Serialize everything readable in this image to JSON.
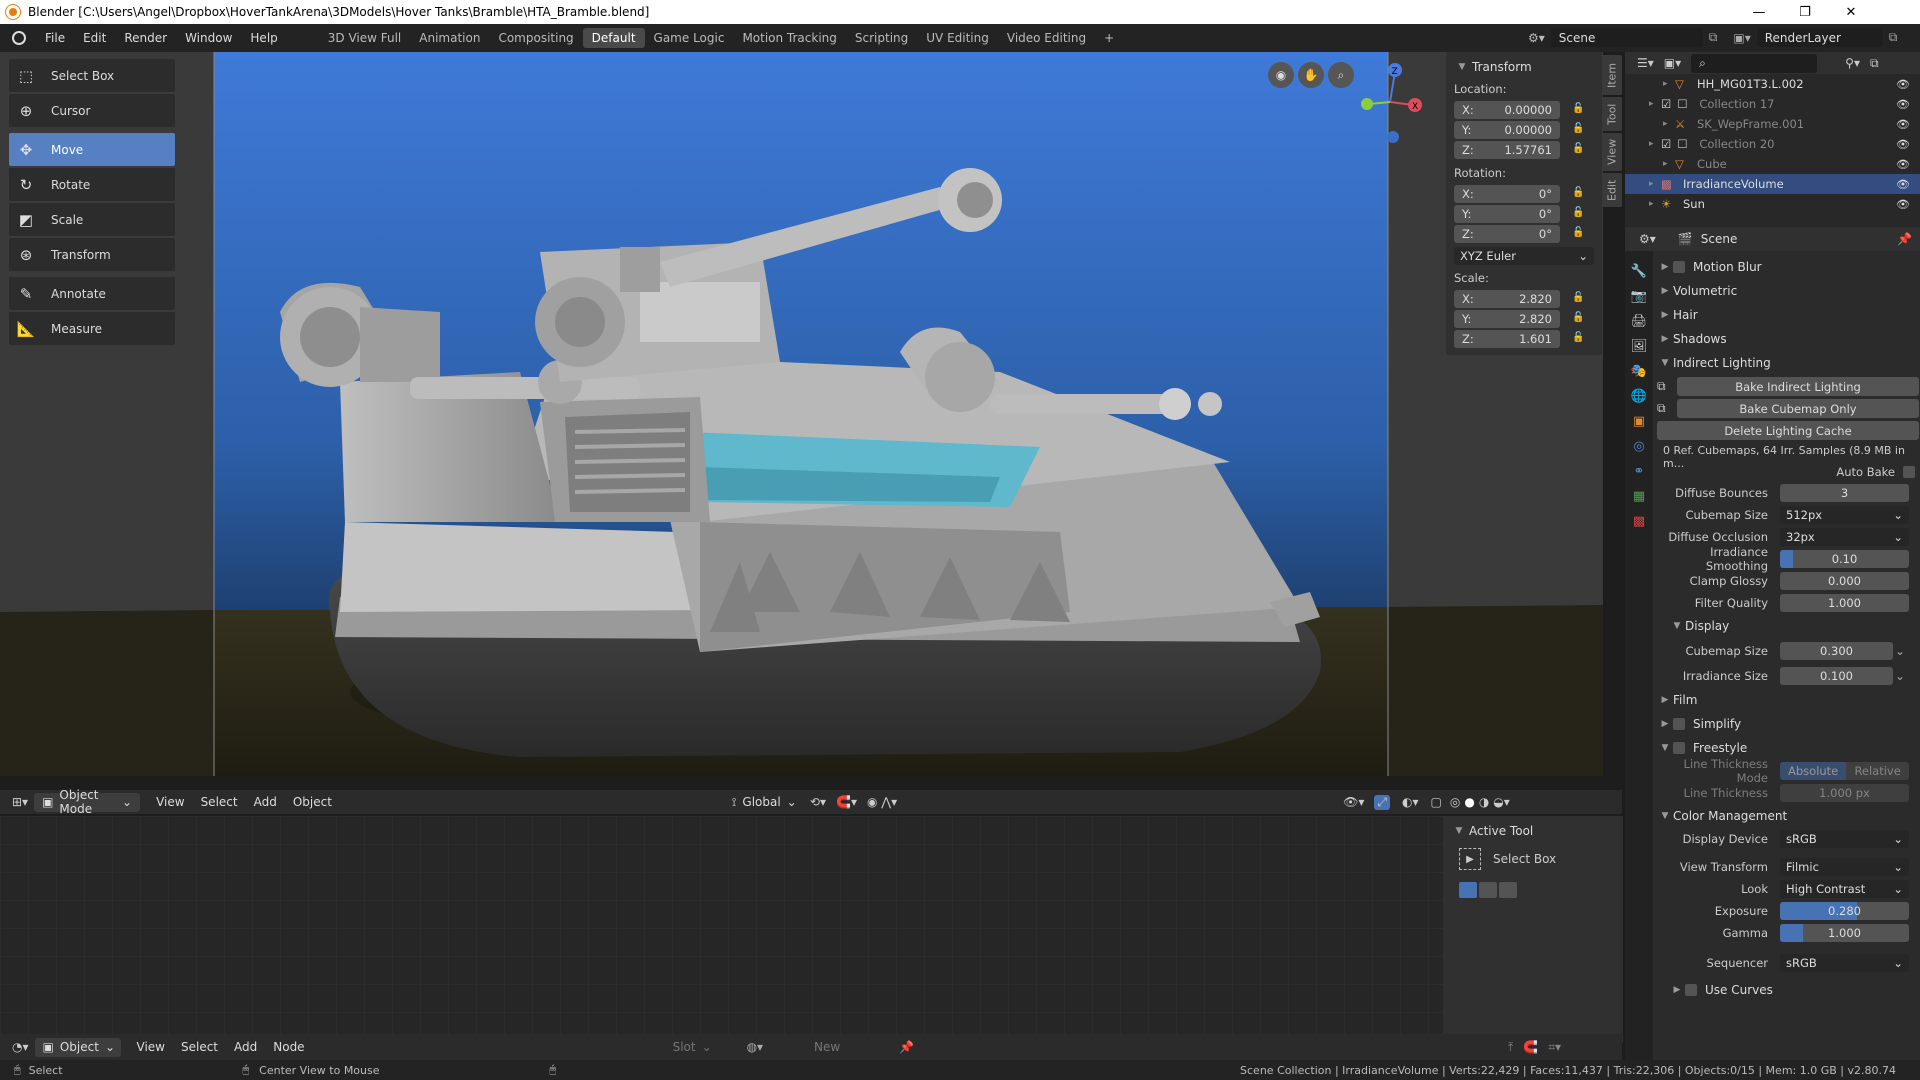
{
  "titlebar": {
    "title": "Blender [C:\\Users\\Angel\\Dropbox\\HoverTankArena\\3DModels\\Hover Tanks\\Bramble\\HTA_Bramble.blend]",
    "minimize": "—",
    "maximize": "❐",
    "close": "✕"
  },
  "menus": [
    "File",
    "Edit",
    "Render",
    "Window",
    "Help"
  ],
  "workspaces": [
    {
      "label": "3D View Full"
    },
    {
      "label": "Animation"
    },
    {
      "label": "Compositing"
    },
    {
      "label": "Default",
      "active": true
    },
    {
      "label": "Game Logic"
    },
    {
      "label": "Motion Tracking"
    },
    {
      "label": "Scripting"
    },
    {
      "label": "UV Editing"
    },
    {
      "label": "Video Editing"
    }
  ],
  "workspace_add": "+",
  "scene": {
    "label": "Scene",
    "render_layer": "RenderLayer"
  },
  "tools": [
    {
      "label": "Select Box",
      "icon": "select-box-icon"
    },
    {
      "label": "Cursor",
      "icon": "cursor-icon"
    },
    {
      "label": "Move",
      "icon": "move-icon",
      "active": true
    },
    {
      "label": "Rotate",
      "icon": "rotate-icon"
    },
    {
      "label": "Scale",
      "icon": "scale-icon"
    },
    {
      "label": "Transform",
      "icon": "transform-icon"
    },
    {
      "label": "Annotate",
      "icon": "annotate-icon"
    },
    {
      "label": "Measure",
      "icon": "measure-icon"
    }
  ],
  "transform": {
    "title": "Transform",
    "location_label": "Location:",
    "location": [
      {
        "axis": "X:",
        "value": "0.00000"
      },
      {
        "axis": "Y:",
        "value": "0.00000"
      },
      {
        "axis": "Z:",
        "value": "1.57761"
      }
    ],
    "rotation_label": "Rotation:",
    "rotation": [
      {
        "axis": "X:",
        "value": "0°"
      },
      {
        "axis": "Y:",
        "value": "0°"
      },
      {
        "axis": "Z:",
        "value": "0°"
      }
    ],
    "rotation_mode": "XYZ Euler",
    "scale_label": "Scale:",
    "scale": [
      {
        "axis": "X:",
        "value": "2.820"
      },
      {
        "axis": "Y:",
        "value": "2.820"
      },
      {
        "axis": "Z:",
        "value": "1.601"
      }
    ]
  },
  "sidebar_tabs": [
    "Item",
    "Tool",
    "View",
    "Edit"
  ],
  "viewport_header": {
    "mode": "Object Mode",
    "menus": [
      "View",
      "Select",
      "Add",
      "Object"
    ],
    "orientation": "Global"
  },
  "active_tool": {
    "title": "Active Tool",
    "tool": "Select Box"
  },
  "node_header": {
    "mode": "Object",
    "menus": [
      "View",
      "Select",
      "Add",
      "Node"
    ],
    "slot": "Slot",
    "new": "New"
  },
  "outliner": [
    {
      "label": "HH_MG01T3.L.002",
      "indent": 2,
      "icon": "mesh-icon",
      "visible": true
    },
    {
      "label": "Collection 17",
      "indent": 1,
      "icon": "collection-icon",
      "dim": true
    },
    {
      "label": "SK_WepFrame.001",
      "indent": 2,
      "icon": "armature-icon",
      "dim": true
    },
    {
      "label": "Collection 20",
      "indent": 1,
      "icon": "collection-icon",
      "dim": true
    },
    {
      "label": "Cube",
      "indent": 2,
      "icon": "mesh-icon",
      "dim": true
    },
    {
      "label": "IrradianceVolume",
      "indent": 1,
      "icon": "irradiance-icon",
      "selected": true
    },
    {
      "label": "Sun",
      "indent": 1,
      "icon": "light-icon"
    }
  ],
  "properties": {
    "context": "Scene",
    "motion_blur": "Motion Blur",
    "volumetric": "Volumetric",
    "hair": "Hair",
    "shadows": "Shadows",
    "indirect_lighting": "Indirect Lighting",
    "bake_indirect": "Bake Indirect Lighting",
    "bake_cubemap": "Bake Cubemap Only",
    "delete_cache": "Delete Lighting Cache",
    "cache_info": "0 Ref. Cubemaps, 64 Irr. Samples (8.9 MB in m...",
    "auto_bake": "Auto Bake",
    "fields": [
      {
        "k": "Diffuse Bounces",
        "v": "3",
        "type": "num"
      },
      {
        "k": "Cubemap Size",
        "v": "512px",
        "type": "sel"
      },
      {
        "k": "Diffuse Occlusion",
        "v": "32px",
        "type": "sel"
      },
      {
        "k": "Irradiance Smoothing",
        "v": "0.10",
        "type": "bar",
        "fill": 0.1
      },
      {
        "k": "Clamp Glossy",
        "v": "0.000",
        "type": "num"
      },
      {
        "k": "Filter Quality",
        "v": "1.000",
        "type": "num"
      }
    ],
    "display": "Display",
    "display_fields": [
      {
        "k": "Cubemap Size",
        "v": "0.300"
      },
      {
        "k": "Irradiance Size",
        "v": "0.100"
      }
    ],
    "film": "Film",
    "simplify": "Simplify",
    "freestyle": "Freestyle",
    "line_thickness_mode": "Line Thickness Mode",
    "absolute": "Absolute",
    "relative": "Relative",
    "line_thickness": "Line Thickness",
    "line_thickness_value": "1.000 px",
    "color_management": "Color Management",
    "cm_fields": [
      {
        "k": "Display Device",
        "v": "sRGB",
        "type": "sel"
      },
      {
        "k": "View Transform",
        "v": "Filmic",
        "type": "sel"
      },
      {
        "k": "Look",
        "v": "High Contrast",
        "type": "sel"
      },
      {
        "k": "Exposure",
        "v": "0.280",
        "type": "bar",
        "fill": 0.6
      },
      {
        "k": "Gamma",
        "v": "1.000",
        "type": "bar",
        "fill": 0.18
      }
    ],
    "sequencer": "Sequencer",
    "sequencer_value": "sRGB",
    "use_curves": "Use Curves"
  },
  "status": {
    "select": "Select",
    "center": "Center View to Mouse",
    "info": "Scene Collection | IrradianceVolume | Verts:22,429 | Faces:11,437 | Tris:22,306 | Objects:0/15 | Mem: 1.0 GB | v2.80.74"
  },
  "colors": {
    "accent": "#4772b3",
    "active_tool": "#5680c2",
    "sky_top": "#3d78d6",
    "sky_bottom": "#1f4a8a",
    "ground": "#2a2a1c",
    "tank": "#8e8e8e",
    "glass": "#5fb8cc"
  }
}
